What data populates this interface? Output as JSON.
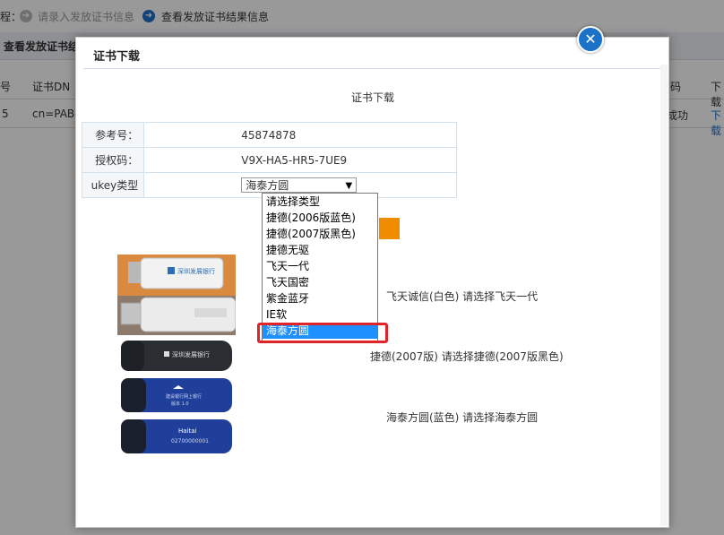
{
  "background": {
    "steps": {
      "prefix": "程：",
      "step1_icon": "arrow-right-circle-icon",
      "step1_label": "请录入发放证书信息",
      "step2_icon": "arrow-right-circle-icon",
      "step2_label": "查看发放证书结果信息"
    },
    "section_title": "查看发放证书结",
    "table": {
      "headers": [
        "号",
        "证书DN",
        "码",
        "下载"
      ],
      "row": [
        "5",
        "cn=PAB@",
        "成功",
        "下载"
      ]
    }
  },
  "modal": {
    "title": "证书下载",
    "close_icon": "close-circle-icon",
    "heading": "证书下载",
    "fields": [
      {
        "label": "参考号：",
        "value": "45874878"
      },
      {
        "label": "授权码：",
        "value": "V9X-HA5-HR5-7UE9"
      },
      {
        "label": "ukey类型",
        "value": "海泰方圆"
      }
    ],
    "dropdown": {
      "options": [
        "请选择类型",
        "捷德(2006版蓝色)",
        "捷德(2007版黑色)",
        "捷德无驱",
        "飞天一代",
        "飞天国密",
        "紫金蓝牙",
        "IE软",
        "海泰方圆"
      ],
      "selected": "海泰方圆"
    },
    "products": [
      {
        "caption": "飞天诚信(白色) 请选择飞天一代",
        "image": "white-usb-key-image",
        "brand": "深圳发展银行"
      },
      {
        "caption": "捷德(2007版) 请选择捷德(2007版黑色)",
        "image": "black-usb-key-image",
        "brand": "深圳发展银行"
      },
      {
        "caption": "海泰方圆(蓝色) 请选择海泰方圆",
        "image": "blue-usb-key-image",
        "brand": "Haitai",
        "serial": "02700000001"
      }
    ]
  },
  "colors": {
    "accent": "#1e6fc9",
    "selected_option": "#1e90ff",
    "highlight": "#e0242a",
    "button": "#f08c00"
  }
}
